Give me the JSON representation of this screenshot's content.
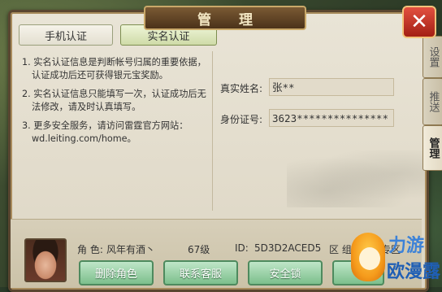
{
  "window": {
    "title": "管 理",
    "close_glyph": "✕"
  },
  "tabs": [
    {
      "label": "手机认证",
      "active": false
    },
    {
      "label": "实名认证",
      "active": true
    }
  ],
  "notes": [
    "1. 实名认证信息是判断帐号归属的重要依据，认证成功后还可获得银元宝奖励。",
    "2. 实名认证信息只能填写一次，认证成功后无法修改，请及时认真填写。",
    "3. 更多安全服务，请访问雷霆官方网站：wd.leiting.com/home。"
  ],
  "form": {
    "name_label": "真实姓名:",
    "name_value": "张**",
    "id_label": "身份证号:",
    "id_value": "3623***************"
  },
  "character": {
    "role_label": "角 色:",
    "role_value": "风年有酒丶",
    "level": "67级",
    "id_label": "ID:",
    "id_value": "5D3D2ACED5",
    "zone_label": "区 组:",
    "zone_value": "内测专区"
  },
  "actions": [
    {
      "label": "删除角色"
    },
    {
      "label": "联系客服"
    },
    {
      "label": "安全锁"
    }
  ],
  "side_tabs": [
    {
      "label": "设置",
      "active": false
    },
    {
      "label": "推送",
      "active": false
    },
    {
      "label": "管理",
      "active": true
    }
  ],
  "watermark": {
    "line1": "力游",
    "line2": "欧漫露"
  },
  "colors": {
    "panel_bg": "#e9e4d6",
    "title_bar": "#5a3d20",
    "close_red": "#c43526",
    "action_green": "#7cbf8c",
    "active_tab": "#cfdba8"
  }
}
